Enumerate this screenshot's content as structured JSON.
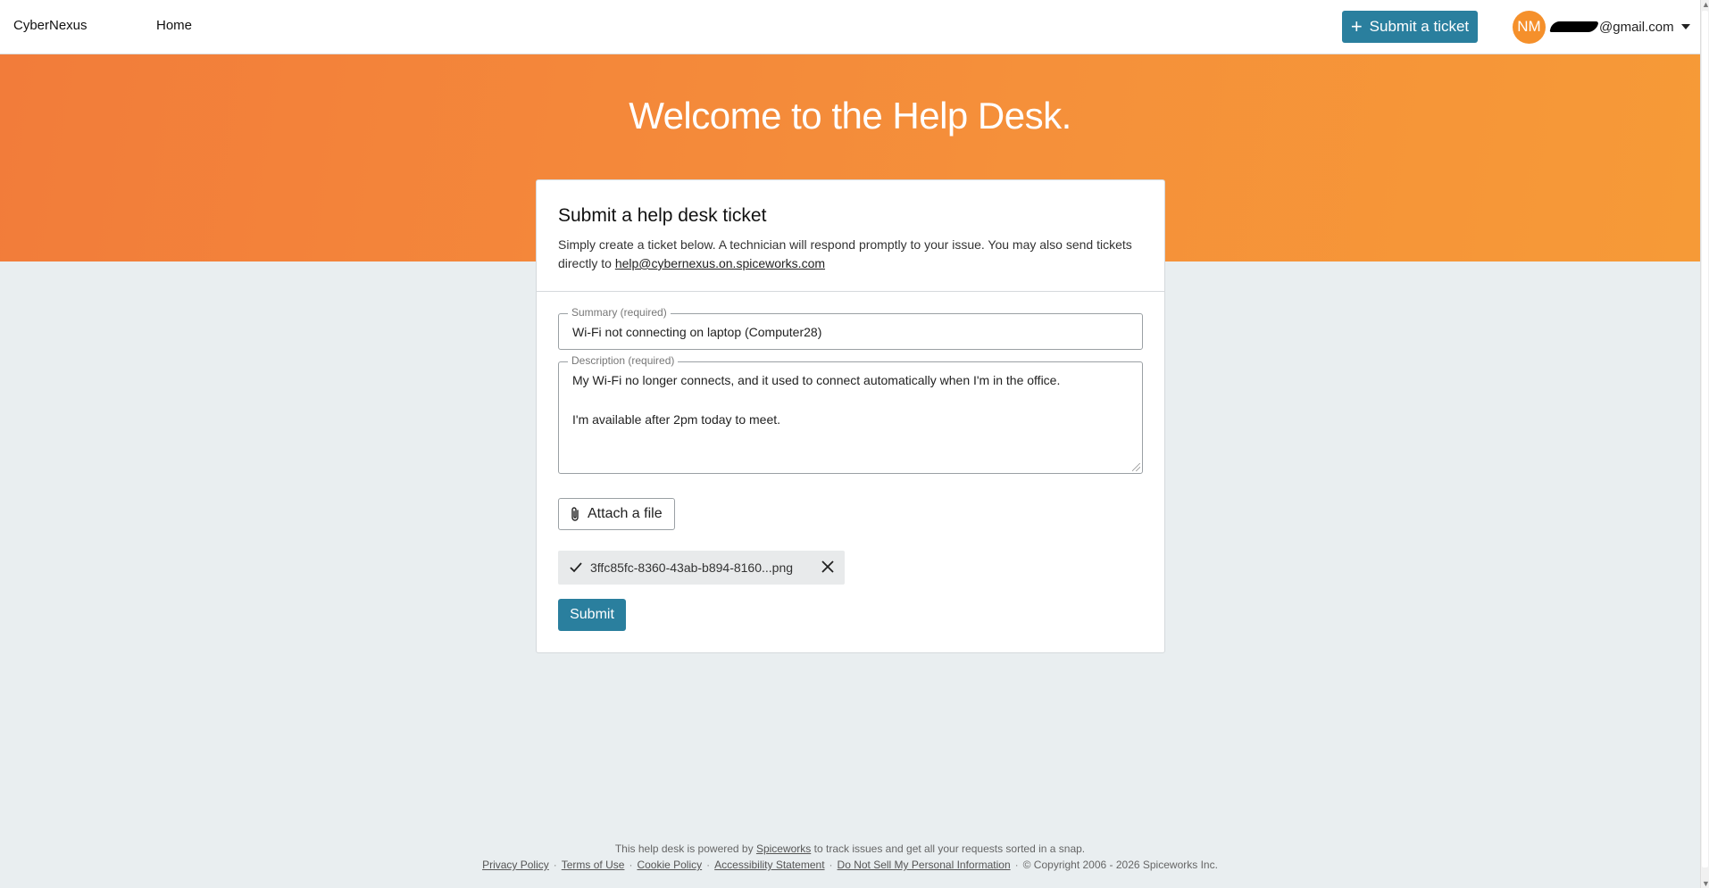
{
  "header": {
    "brand": "CyberNexus",
    "nav_home": "Home",
    "submit_ticket_label": "Submit a ticket",
    "avatar_initials": "NM",
    "email_suffix": "@gmail.com"
  },
  "hero": {
    "title": "Welcome to the Help Desk."
  },
  "form": {
    "title": "Submit a help desk ticket",
    "description": "Simply create a ticket below. A technician will respond promptly to your issue. You may also send tickets directly to",
    "email_link": "help@cybernexus.on.spiceworks.com",
    "summary_label": "Summary (required)",
    "summary_value": "Wi-Fi not connecting on laptop (Computer28)",
    "description_label": "Description (required)",
    "description_value": "My Wi-Fi no longer connects, and it used to connect automatically when I'm in the office.\n\nI'm available after 2pm today to meet.",
    "attach_label": "Attach a file",
    "attached_file": "3ffc85fc-8360-43ab-b894-8160...png",
    "submit_label": "Submit"
  },
  "footer": {
    "powered_prefix": "This help desk is powered by",
    "powered_link": "Spiceworks",
    "powered_suffix": "to track issues and get all your requests sorted in a snap.",
    "links": [
      "Privacy Policy",
      "Terms of Use",
      "Cookie Policy",
      "Accessibility Statement",
      "Do Not Sell My Personal Information"
    ],
    "copyright": "© Copyright 2006 - 2026 Spiceworks Inc."
  },
  "colors": {
    "accent": "#2a7f9e",
    "hero_orange": "#f5903a",
    "avatar": "#f5902b",
    "background": "#e9eef0"
  }
}
